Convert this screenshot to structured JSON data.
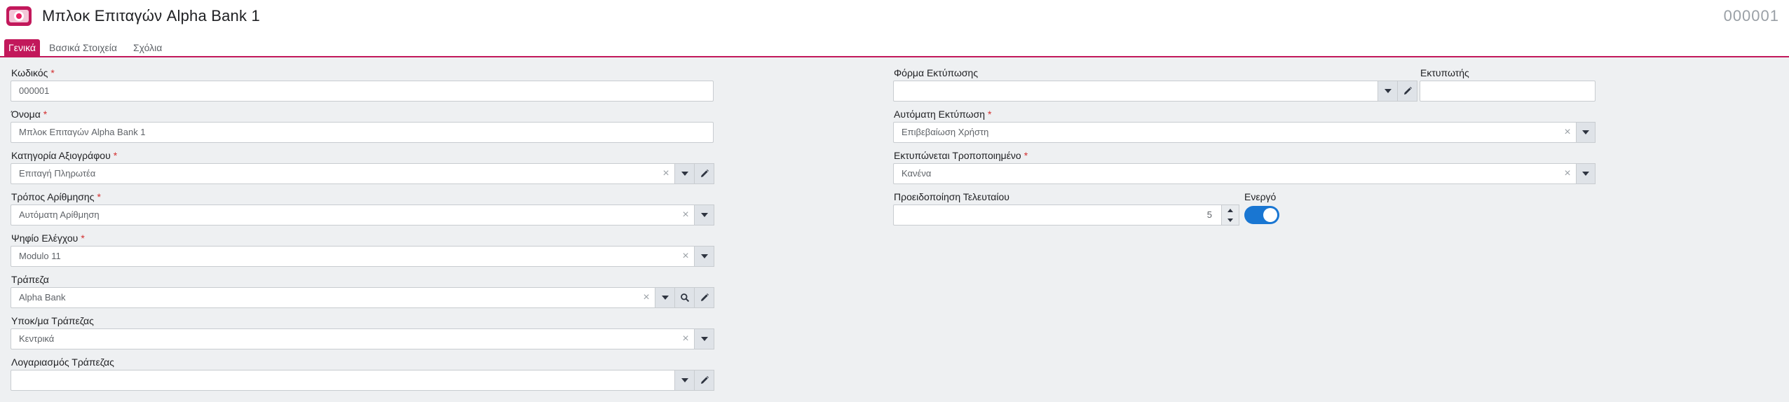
{
  "header": {
    "title": "Μπλοκ Επιταγών Alpha Bank 1",
    "record_code": "000001"
  },
  "tabs": [
    {
      "label": "Γενικά",
      "active": true
    },
    {
      "label": "Βασικά Στοιχεία",
      "active": false
    },
    {
      "label": "Σχόλια",
      "active": false
    }
  ],
  "fields": {
    "code": {
      "label": "Κωδικός",
      "required": "*",
      "value": "000001"
    },
    "name": {
      "label": "Όνομα",
      "required": "*",
      "value": "Μπλοκ Επιταγών Alpha Bank 1"
    },
    "security_category": {
      "label": "Κατηγορία Αξιογράφου",
      "required": "*",
      "value": "Επιταγή  Πληρωτέα"
    },
    "numbering_method": {
      "label": "Τρόπος Αρίθμησης",
      "required": "*",
      "value": "Αυτόματη Αρίθμηση"
    },
    "check_digit": {
      "label": "Ψηφίο Ελέγχου",
      "required": "*",
      "value": "Modulo 11"
    },
    "bank": {
      "label": "Τράπεζα",
      "value": "Alpha Bank"
    },
    "bank_branch": {
      "label": "Υποκ/μα Τράπεζας",
      "value": "Κεντρικά"
    },
    "bank_account": {
      "label": "Λογαριασμός Τράπεζας",
      "value": ""
    },
    "print_form": {
      "label": "Φόρμα Εκτύπωσης",
      "value": ""
    },
    "printer": {
      "label": "Εκτυπωτής",
      "value": ""
    },
    "auto_print": {
      "label": "Αυτόματη Εκτύπωση",
      "required": "*",
      "value": "Επιβεβαίωση Χρήστη"
    },
    "print_modified": {
      "label": "Εκτυπώνεται Τροποποιημένο",
      "required": "*",
      "value": "Κανένα"
    },
    "last_warning": {
      "label": "Προειδοποίηση Τελευταίου",
      "value": "5"
    },
    "active": {
      "label": "Ενεργό",
      "value": true
    }
  },
  "colors": {
    "accent": "#c2185b",
    "toggle_on": "#1976d2",
    "required": "#d32f2f"
  },
  "icons": {
    "clear": "×",
    "dropdown": "caret-down-icon",
    "edit": "pencil-icon",
    "search": "magnifier-icon"
  }
}
